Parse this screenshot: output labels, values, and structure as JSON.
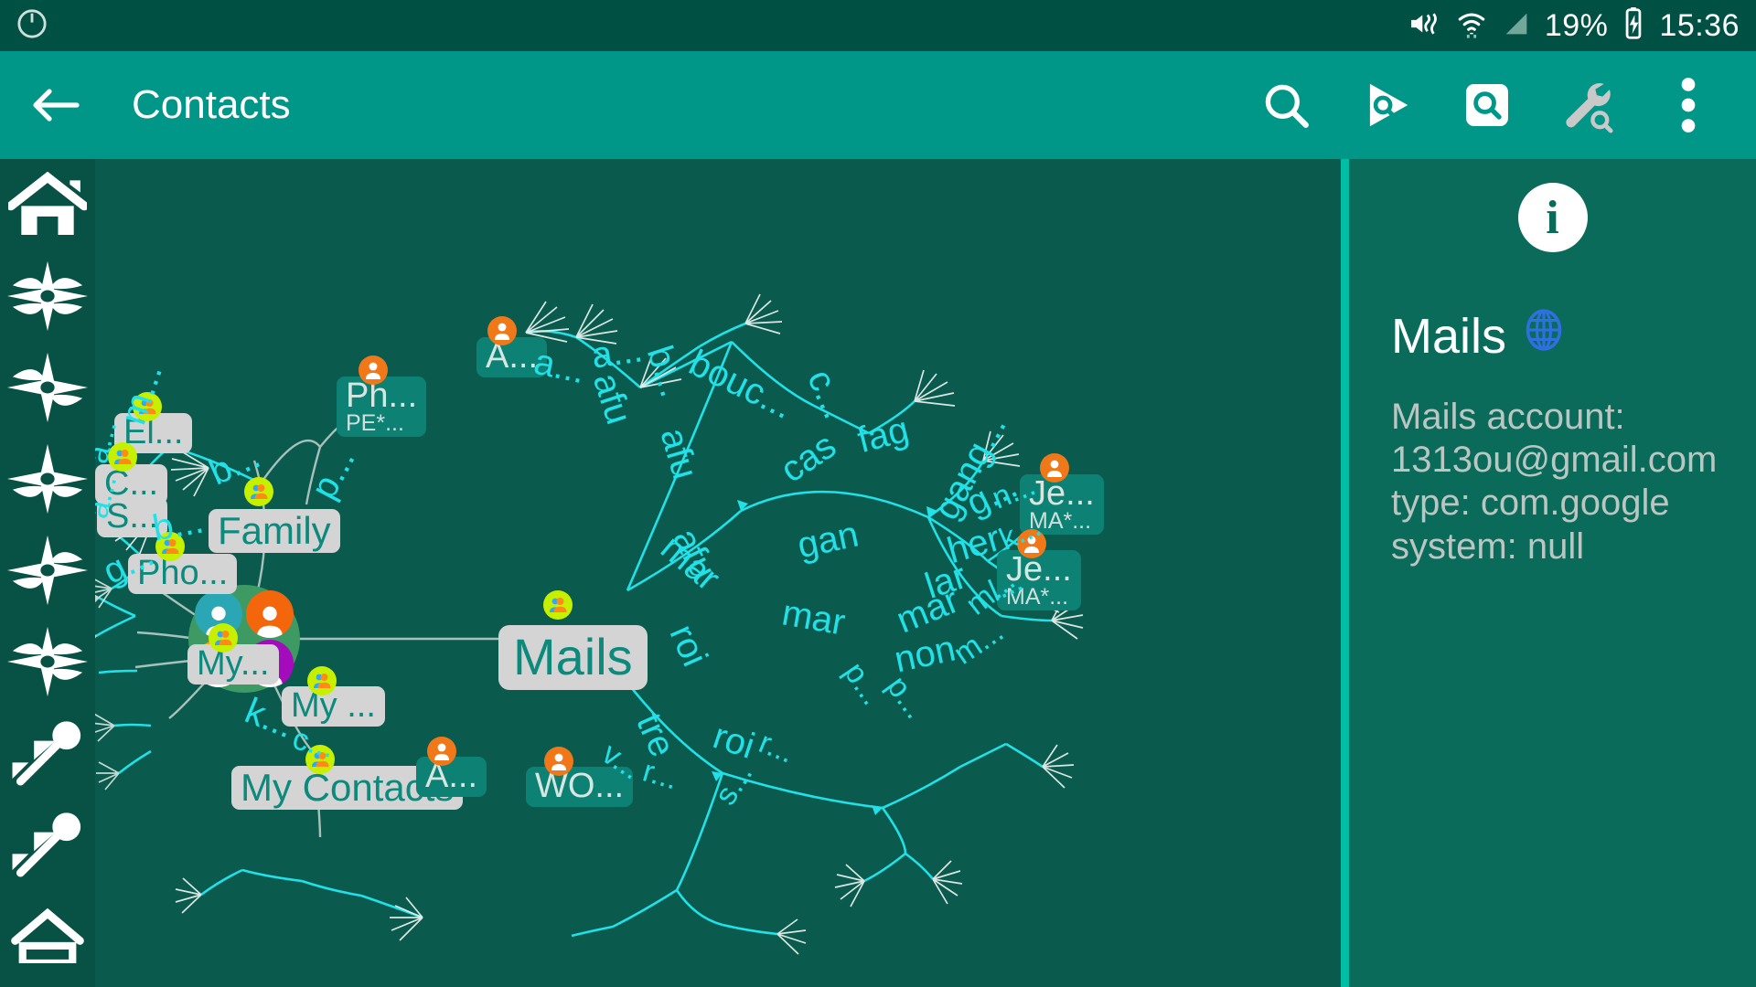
{
  "status_bar": {
    "time": "15:36",
    "battery_percent": "19%",
    "icons": [
      "mute-vibrate-icon",
      "wifi-icon",
      "signal-icon",
      "battery-charging-icon"
    ]
  },
  "toolbar": {
    "back_label": "back-arrow",
    "title": "Contacts",
    "actions": [
      {
        "name": "search-icon",
        "label": "Search"
      },
      {
        "name": "play-search-icon",
        "label": "Play search"
      },
      {
        "name": "boxed-search-icon",
        "label": "Boxed search"
      },
      {
        "name": "wrench-search-icon",
        "label": "Tools"
      },
      {
        "name": "overflow-menu-icon",
        "label": "More options"
      }
    ]
  },
  "rail": {
    "items": [
      {
        "name": "home-icon",
        "label": "Home"
      },
      {
        "name": "compass-icon-1",
        "label": "Navigate 1"
      },
      {
        "name": "compass-icon-2",
        "label": "Navigate 2"
      },
      {
        "name": "compass-icon-3",
        "label": "Navigate 3"
      },
      {
        "name": "compass-icon-4",
        "label": "Navigate 4"
      },
      {
        "name": "compass-icon-5",
        "label": "Navigate 5"
      },
      {
        "name": "pin-icon-1",
        "label": "Pin 1"
      },
      {
        "name": "pin-icon-2",
        "label": "Pin 2"
      },
      {
        "name": "home-outline-icon",
        "label": "Home outline"
      }
    ]
  },
  "info_panel": {
    "icon": "info-icon",
    "title": "Mails",
    "title_badge": "globe-icon",
    "details": "Mails\naccount: 1313ou@gmail.com\ntype: com.google\nsystem: null"
  },
  "graph": {
    "center_label": "Mails",
    "group_nodes": [
      {
        "label": "Family"
      },
      {
        "label": "My Contacts"
      },
      {
        "label": "Mails"
      }
    ],
    "contact_chips": [
      {
        "label": "Ph...",
        "sub": "PE*...",
        "style": "teal"
      },
      {
        "label": "A...",
        "sub": "",
        "style": "teal"
      },
      {
        "label": "El...",
        "sub": "",
        "style": "grey"
      },
      {
        "label": "C...",
        "sub": "",
        "style": "grey"
      },
      {
        "label": "S...",
        "sub": "",
        "style": "grey"
      },
      {
        "label": "Pho...",
        "sub": "",
        "style": "grey"
      },
      {
        "label": "My...",
        "sub": "",
        "style": "grey"
      },
      {
        "label": "My ...",
        "sub": "",
        "style": "grey"
      },
      {
        "label": "A...",
        "sub": "",
        "style": "teal"
      },
      {
        "label": "WO...",
        "sub": "",
        "style": "teal"
      },
      {
        "label": "Je...",
        "sub": "MA*...",
        "style": "teal"
      },
      {
        "label": "Je...",
        "sub": "MA*...",
        "style": "teal"
      }
    ],
    "edge_labels": [
      "a...",
      "a...",
      "b...",
      "bouc...",
      "c...",
      "fag",
      "afu",
      "afu",
      "afu",
      "cas",
      "gan",
      "gang...",
      "g...",
      "n...",
      "her",
      "k...",
      "lar",
      "l...",
      "b...",
      "b...",
      "m...",
      "p...",
      "a...",
      "a...",
      "g...",
      "mar",
      "mar",
      "mar",
      "m...",
      "m...",
      "non",
      "roi",
      "roi",
      "r...",
      "p...",
      "p...",
      "k...",
      "c...",
      "v...",
      "tre",
      "r...",
      "s..."
    ]
  },
  "colors": {
    "statusbar": "#005043",
    "toolbar": "#009688",
    "graph_bg": "#0a5b4e",
    "rail_bg": "#075245",
    "info_bg": "#0a6b5b",
    "accent_cyan": "#22e0e8",
    "chip_bg": "#d4d4d4",
    "chip_text": "#0b8a7d",
    "divider": "#00bfa5"
  }
}
